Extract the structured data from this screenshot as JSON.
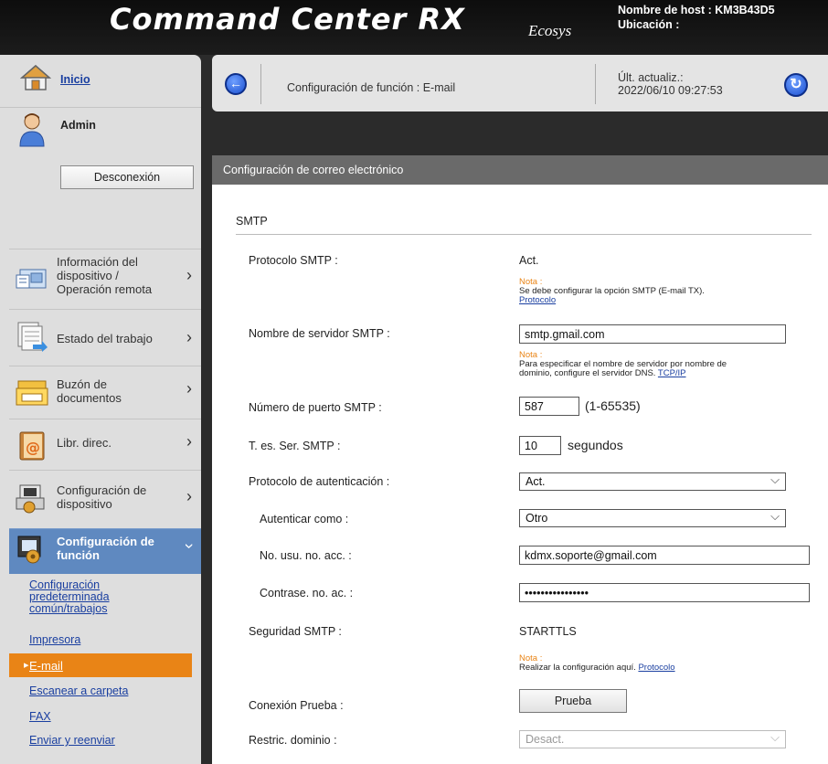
{
  "header": {
    "brand": "Command Center RX",
    "sub_brand": "Ecosys",
    "host_label": "Nombre de host : KM3B43D5",
    "location_label": "Ubicación :"
  },
  "sidebar": {
    "home": "Inicio",
    "user": "Admin",
    "logout": "Desconexión",
    "items": [
      {
        "label_1": "Información del",
        "label_2": "dispositivo /",
        "label_3": "Operación remota"
      },
      {
        "label": "Estado del trabajo"
      },
      {
        "label_1": "Buzón de",
        "label_2": "documentos"
      },
      {
        "label": "Libr. direc."
      },
      {
        "label_1": "Configuración de",
        "label_2": "dispositivo"
      },
      {
        "label_1": "Configuración de",
        "label_2": "función"
      }
    ],
    "sub_items": [
      {
        "label_1": "Configuración",
        "label_2": "predeterminada",
        "label_3": "común/trabajos"
      },
      {
        "label": "Impresora"
      },
      {
        "label": "E-mail"
      },
      {
        "label": "Escanear a carpeta"
      },
      {
        "label": "FAX"
      },
      {
        "label": "Enviar y reenviar"
      }
    ]
  },
  "topbar": {
    "title": "Configuración de función : E-mail",
    "updated_label": "Últ. actualiz.:",
    "updated_value": "2022/06/10 09:27:53"
  },
  "section": {
    "title": "Configuración de correo electrónico",
    "group": "SMTP"
  },
  "form": {
    "smtp_protocol": {
      "label": "Protocolo SMTP :",
      "value": "Act."
    },
    "note1": {
      "prefix": "Nota :",
      "text": "Se debe configurar la opción SMTP (E-mail TX).",
      "link": "Protocolo"
    },
    "server": {
      "label": "Nombre de servidor SMTP :",
      "value": "smtp.gmail.com"
    },
    "note2": {
      "prefix": "Nota :",
      "text_1": "Para especificar el nombre de servidor por nombre de",
      "text_2": "dominio, configure el servidor DNS.",
      "link": "TCP/IP"
    },
    "port": {
      "label": "Número de puerto SMTP :",
      "value": "587",
      "range": "(1-65535)"
    },
    "timeout": {
      "label": "T. es. Ser. SMTP :",
      "value": "10",
      "unit": "segundos"
    },
    "auth_protocol": {
      "label": "Protocolo de autenticación :",
      "value": "Act."
    },
    "auth_as": {
      "label": "Autenticar como :",
      "value": "Otro"
    },
    "account": {
      "label": "No. usu. no. acc. :",
      "value": "kdmx.soporte@gmail.com"
    },
    "password": {
      "label": "Contrase. no. ac. :",
      "value": "••••••••••••••••"
    },
    "security": {
      "label": "Seguridad SMTP :",
      "value": "STARTTLS"
    },
    "note3": {
      "prefix": "Nota :",
      "text": "Realizar la configuración aquí.",
      "link": "Protocolo"
    },
    "test": {
      "label": "Conexión Prueba :",
      "button": "Prueba"
    },
    "domain": {
      "label": "Restric. dominio :",
      "value": "Desact."
    }
  },
  "colors": {
    "accent_orange": "#e98416",
    "nav_active": "#5f89c0",
    "link": "#1a3fa0",
    "section_bar": "#6a6a6a"
  }
}
